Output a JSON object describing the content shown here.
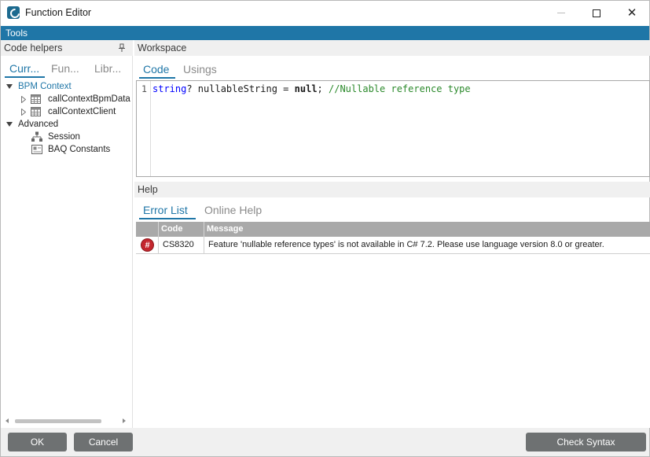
{
  "window": {
    "title": "Function Editor",
    "icon": "epicor-e-icon"
  },
  "toolbar": {
    "label": "Tools"
  },
  "code_helpers": {
    "title": "Code helpers",
    "tabs": [
      {
        "label": "Curr...",
        "active": true
      },
      {
        "label": "Fun...",
        "active": false
      },
      {
        "label": "Libr...",
        "active": false
      }
    ],
    "tree": {
      "bpm_context": {
        "label": "BPM Context",
        "children": [
          {
            "label": "callContextBpmData",
            "icon": "table-icon"
          },
          {
            "label": "callContextClient",
            "icon": "table-icon"
          }
        ]
      },
      "advanced": {
        "label": "Advanced",
        "children": [
          {
            "label": "Session",
            "icon": "hierarchy-icon"
          },
          {
            "label": "BAQ Constants",
            "icon": "constants-icon"
          }
        ]
      }
    }
  },
  "workspace": {
    "title": "Workspace",
    "tabs": [
      {
        "label": "Code",
        "active": true
      },
      {
        "label": "Usings",
        "active": false
      }
    ],
    "code": {
      "line_number": "1",
      "tokens": {
        "type": "string",
        "rest1": "? nullableString = ",
        "null_kw": "null",
        "semi": "; ",
        "comment": "//Nullable reference type"
      }
    }
  },
  "help": {
    "title": "Help",
    "tabs": [
      {
        "label": "Error List",
        "active": true
      },
      {
        "label": "Online Help",
        "active": false
      }
    ],
    "columns": {
      "code": "Code",
      "message": "Message"
    },
    "errors": [
      {
        "severity_icon": "#",
        "code": "CS8320",
        "message": "Feature 'nullable reference types' is not available in C# 7.2. Please use language version 8.0 or greater."
      }
    ]
  },
  "footer": {
    "ok": "OK",
    "cancel": "Cancel",
    "check_syntax": "Check Syntax"
  },
  "colors": {
    "accent": "#1f76a7",
    "button": "#6e7172",
    "error": "#c4262e",
    "keyword": "#0000ff",
    "comment": "#2c8a2c"
  }
}
